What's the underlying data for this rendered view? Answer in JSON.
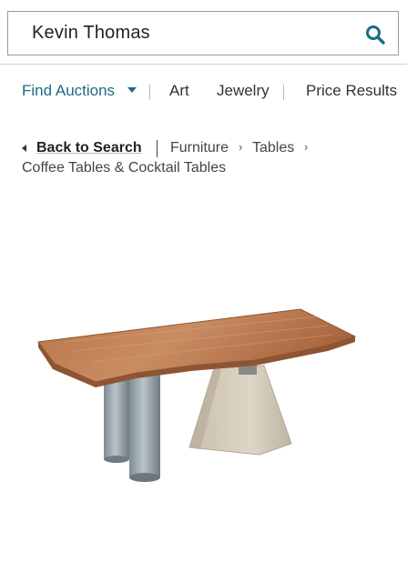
{
  "search": {
    "value": "Kevin Thomas"
  },
  "nav": {
    "find_auctions": "Find Auctions",
    "art": "Art",
    "jewelry": "Jewelry",
    "price_results": "Price Results"
  },
  "breadcrumb": {
    "back": "Back to Search",
    "furniture": "Furniture",
    "tables": "Tables",
    "coffee_tables": "Coffee Tables & Cocktail Tables"
  },
  "colors": {
    "accent": "#1d6a8a",
    "border": "#9a9a9a"
  },
  "icons": [
    "search-icon",
    "chevron-down-icon",
    "chevron-left-icon",
    "chevron-right-icon"
  ]
}
